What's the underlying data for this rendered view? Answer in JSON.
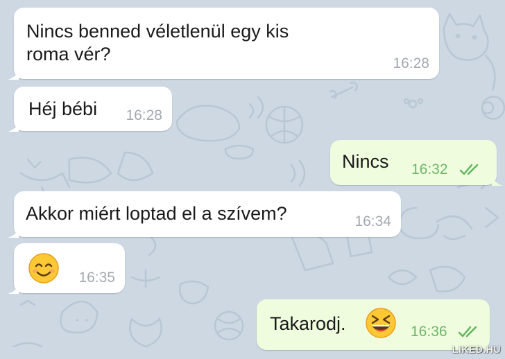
{
  "messages": [
    {
      "direction": "incoming",
      "lines": [
        "Nincs benned véletlenül egy kis",
        "roma vér?"
      ],
      "time": "16:28"
    },
    {
      "direction": "incoming",
      "text": "Héj bébi",
      "time": "16:28"
    },
    {
      "direction": "outgoing",
      "text": "Nincs",
      "time": "16:32",
      "status": "read"
    },
    {
      "direction": "incoming",
      "text": "Akkor miért loptad el a szívem?",
      "time": "16:34"
    },
    {
      "direction": "incoming",
      "emoji": "smiling-face-emoji",
      "time": "16:35"
    },
    {
      "direction": "outgoing",
      "text": "Takarodj.",
      "emoji": "laughing-face-emoji",
      "time": "16:36",
      "status": "read"
    }
  ],
  "watermark": "LIKED.HU",
  "colors": {
    "wallpaper": "#cdd8e3",
    "incoming_bubble": "#ffffff",
    "outgoing_bubble": "#effdde",
    "incoming_time": "#a2a9b0",
    "outgoing_time": "#6fb46a",
    "read_check": "#5fb45c"
  }
}
